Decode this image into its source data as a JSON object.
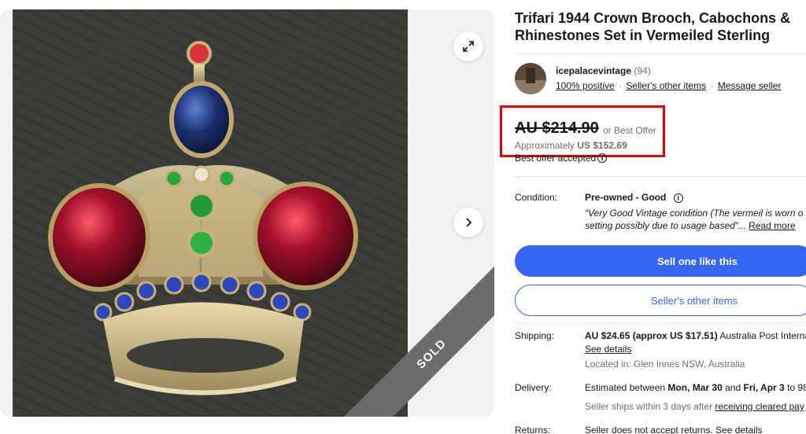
{
  "listing": {
    "title": "Trifari 1944 Crown Brooch, Cabochons & Rhinestones Set in Vermeiled Sterling",
    "sold_label": "SOLD"
  },
  "gallery": {
    "expand_icon": "expand-icon",
    "next_icon": "chevron-right-icon"
  },
  "seller": {
    "name": "icepalacevintage",
    "score": "(94)",
    "positive": "100% positive",
    "other_items_link": "Seller's other items",
    "message_link": "Message seller"
  },
  "price": {
    "amount": "AU $214.90",
    "best_offer": "or Best Offer",
    "approx_label": "Approximately",
    "approx_value": "US $152.69",
    "best_offer_accepted": "Best offer accepted"
  },
  "condition": {
    "label": "Condition:",
    "value": "Pre-owned - Good",
    "quote_line1": "“Very Good Vintage condition (The vermeil is worn o",
    "quote_line2": "setting possibly due to usage based”...",
    "read_more": "Read more"
  },
  "buttons": {
    "sell_one": "Sell one like this",
    "sellers_other_items": "Seller's other items"
  },
  "shipping": {
    "label": "Shipping:",
    "value": "AU $24.65 (approx US $17.51)",
    "service": "Australia Post Internat",
    "see_details": "See details",
    "located": "Located in: Glen Innes NSW, Australia"
  },
  "delivery": {
    "label": "Delivery:",
    "estimated_prefix": "Estimated between",
    "date1": "Mon, Mar 30",
    "and": "and",
    "date2": "Fri, Apr 3",
    "to": "to 98",
    "ships_text": "Seller ships within 3 days after",
    "ships_link": "receiving cleared pay"
  },
  "returns": {
    "label": "Returns:",
    "value": "Seller does not accept returns.",
    "see_details": "See details"
  },
  "colors": {
    "accent_blue": "#3665f3",
    "highlight_red": "#e00000",
    "sold_ribbon": "#6b6b6b"
  }
}
